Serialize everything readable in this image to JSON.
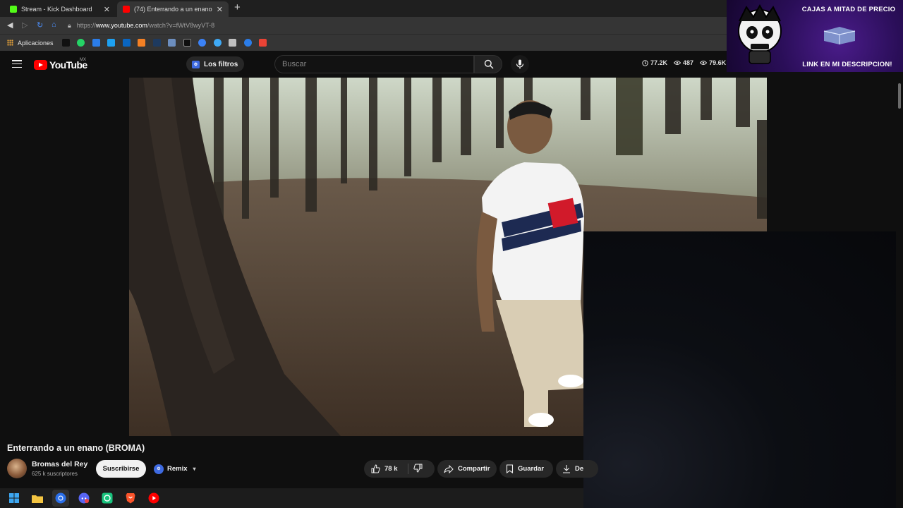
{
  "browser": {
    "tabs": [
      {
        "label": "Stream - Kick Dashboard",
        "favicon_color": "#53fc18",
        "active": false
      },
      {
        "label": "(74) Enterrando a un enano",
        "favicon_color": "#ff0000",
        "active": true
      }
    ],
    "url_prefix": "https://",
    "url_host": "www.youtube.com",
    "url_path": "/watch?v=fWtV8wyVT-8",
    "bookmarks_label": "Aplicaciones",
    "bookmark_icons": [
      "#111111",
      "#25d366",
      "#2b7de9",
      "#1da1f2",
      "#0a66c2",
      "#f48024",
      "#1e3a5f",
      "#6c8ebf",
      "#0f0f0f",
      "#3b82f6",
      "#3fa9f5",
      "#c0c0c0",
      "#2b7de9",
      "#ea4335"
    ]
  },
  "youtube": {
    "logo_text": "YouTube",
    "country": "MX",
    "filters_label": "Los filtros",
    "search_placeholder": "Buscar",
    "stats": [
      "77.2K",
      "487",
      "79.6K"
    ]
  },
  "overlay": {
    "top_text": "CAJAS A MITAD DE PRECIO",
    "bottom_text": "LINK EN MI DESCRIPCION!"
  },
  "video": {
    "title": "Enterrando a un enano (BROMA)",
    "channel": "Bromas del Rey",
    "subscribers": "625 k suscriptores",
    "subscribe_label": "Suscribirse",
    "remix_label": "Remix",
    "likes": "78 k",
    "share_label": "Compartir",
    "save_label": "Guardar",
    "download_label": "De"
  },
  "taskbar": {
    "icons": [
      "windows-start-icon",
      "file-explorer-icon",
      "chrome-icon",
      "discord-icon",
      "chatgpt-icon",
      "brave-icon",
      "youtube-music-icon"
    ]
  }
}
